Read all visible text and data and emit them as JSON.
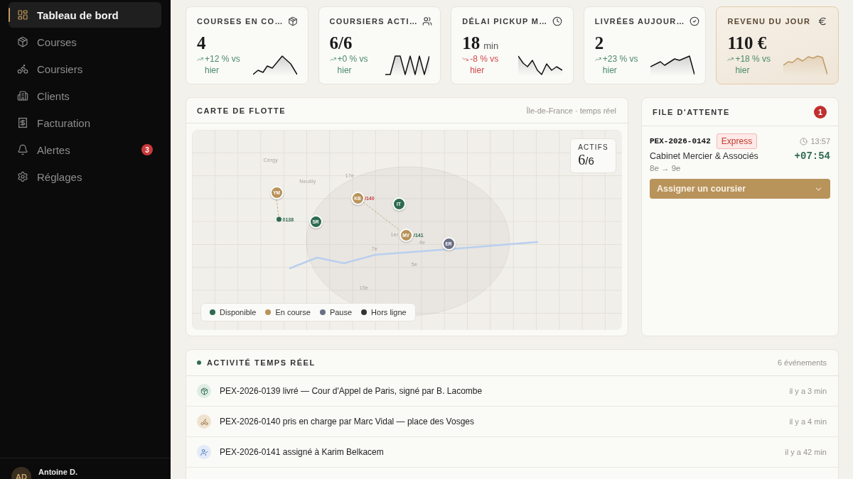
{
  "sidebar": {
    "items": [
      {
        "label": "Tableau de bord",
        "selected": true
      },
      {
        "label": "Courses",
        "selected": false
      },
      {
        "label": "Coursiers",
        "selected": false
      },
      {
        "label": "Clients",
        "selected": false
      },
      {
        "label": "Facturation",
        "selected": false
      },
      {
        "label": "Alertes",
        "selected": false,
        "badge": "3"
      },
      {
        "label": "Réglages",
        "selected": false
      }
    ],
    "user": {
      "initials": "AD",
      "name": "Antoine D."
    }
  },
  "kpis": [
    {
      "title": "COURSES EN CO…",
      "value": "4",
      "delta": "+12 % vs hier",
      "negative": false,
      "highlighted": false
    },
    {
      "title": "COURSIERS ACTI…",
      "value": "6/6",
      "delta": "+0 % vs hier",
      "negative": false,
      "highlighted": false
    },
    {
      "title": "DÉLAI PICKUP M…",
      "value": "18",
      "unit": "min",
      "delta": "-8 % vs hier",
      "negative": true,
      "highlighted": false
    },
    {
      "title": "LIVRÉES AUJOUR…",
      "value": "2",
      "delta": "+23 % vs hier",
      "negative": false,
      "highlighted": false
    },
    {
      "title": "REVENU DU JOUR",
      "value": "110 €",
      "delta": "+18 % vs hier",
      "negative": false,
      "highlighted": true
    }
  ],
  "fleet_map": {
    "title": "CARTE DE FLOTTE",
    "subtitle": "Île-de-France · temps réel",
    "places": [
      "Cergy",
      "Neuilly",
      "17e",
      "1er",
      "4e",
      "7e",
      "5e",
      "15e"
    ],
    "couriers": [
      {
        "initials": "YM",
        "color": "#b8935a"
      },
      {
        "initials": "KB",
        "color": "#b8935a"
      },
      {
        "initials": "IT",
        "color": "#2f6b4f"
      },
      {
        "initials": "SR",
        "color": "#2f6b4f"
      },
      {
        "initials": "MV",
        "color": "#b8935a"
      },
      {
        "initials": "ER",
        "color": "#6b7086"
      }
    ],
    "tags": [
      {
        "label": "0138",
        "color": "#2f6b4f",
        "kind": "pickup"
      },
      {
        "label": "/140",
        "color": "#c94848",
        "kind": "order"
      },
      {
        "label": "/141",
        "color": "#2f6b4f",
        "kind": "order"
      }
    ],
    "counter": {
      "label": "ACTIFS",
      "value": "6",
      "suffix": "/6"
    },
    "legend": [
      {
        "label": "Disponible",
        "color": "#2f6b4f"
      },
      {
        "label": "En course",
        "color": "#b8935a"
      },
      {
        "label": "Pause",
        "color": "#6b7086"
      },
      {
        "label": "Hors ligne",
        "color": "#333333"
      }
    ]
  },
  "queue": {
    "title": "FILE D'ATTENTE",
    "count": "1",
    "items": [
      {
        "ref": "PEX-2026-0142",
        "tag": "Express",
        "time": "13:57",
        "client": "Cabinet Mercier & Associés",
        "elapsed": "+07:54",
        "route": "8e → 9e",
        "action": "Assigner un coursier"
      }
    ]
  },
  "activity": {
    "title": "ACTIVITÉ TEMPS RÉEL",
    "count": "6 événements",
    "events": [
      {
        "kind": "delivered",
        "text": "PEX-2026-0139 livré — Cour d'Appel de Paris, signé par B. Lacombe",
        "time": "il y a 3 min"
      },
      {
        "kind": "picked_up",
        "text": "PEX-2026-0140 pris en charge par Marc Vidal — place des Vosges",
        "time": "il y a 4 min"
      },
      {
        "kind": "assigned",
        "text": "PEX-2026-0141 assigné à Karim Belkacem",
        "time": "il y a 42 min"
      }
    ]
  }
}
